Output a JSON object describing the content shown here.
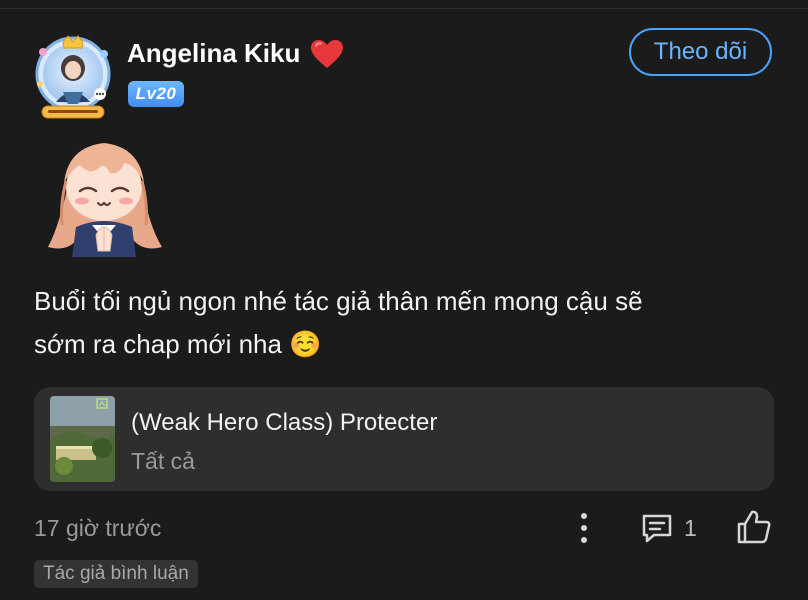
{
  "user": {
    "name": "Angelina Kiku",
    "level_badge": "Lv20",
    "follow_label": "Theo dõi"
  },
  "comment": {
    "line1": "Buổi tối ngủ ngon nhé tác giả thân mến mong cậu sẽ",
    "line2": "sớm ra chap mới nha ☺️"
  },
  "story": {
    "title": "(Weak Hero Class) Protecter",
    "subtitle": "Tất cả"
  },
  "footer": {
    "time": "17 giờ trước",
    "comment_count": "1",
    "author_tag": "Tác giả bình luận"
  },
  "icons": {
    "heart": "red-heart-icon",
    "more": "vertical-dots-icon",
    "comment": "comment-bubble-icon",
    "like": "thumbs-up-icon"
  },
  "colors": {
    "background": "#1b1b1b",
    "accent": "#4aa3ff",
    "card": "#2e2e2e",
    "muted_text": "#9a9a9a"
  }
}
